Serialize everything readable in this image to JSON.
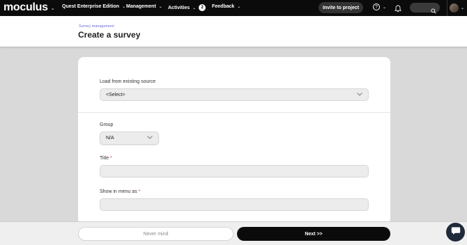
{
  "topbar": {
    "logo": "moculus",
    "nav": [
      {
        "label": "Quest Enterprise Edition"
      },
      {
        "label": "Management"
      },
      {
        "label": "Activities",
        "badge": "2"
      },
      {
        "label": "Feedback"
      }
    ],
    "invite_label": "Invite to project",
    "help_glyph": "?"
  },
  "header": {
    "breadcrumb": "Survey management",
    "title": "Create a survey"
  },
  "form": {
    "source": {
      "label": "Load from existing source",
      "value": "<Select>"
    },
    "group": {
      "label": "Group",
      "value": "N/A"
    },
    "title": {
      "label": "Title",
      "required_mark": "*",
      "value": ""
    },
    "menu": {
      "label": "Show in menu as",
      "required_mark": "*",
      "value": ""
    }
  },
  "footer": {
    "cancel_label": "Never mind",
    "next_label": "Next >>"
  },
  "colors": {
    "nav_bg": "#0b0b0b",
    "breadcrumb": "#6f6fd4",
    "required": "#e23b3b",
    "chat_fab": "#1f2a3a"
  },
  "icons": [
    "chevron-down-icon",
    "help-icon",
    "bell-icon",
    "search-icon",
    "avatar",
    "chat-icon"
  ]
}
